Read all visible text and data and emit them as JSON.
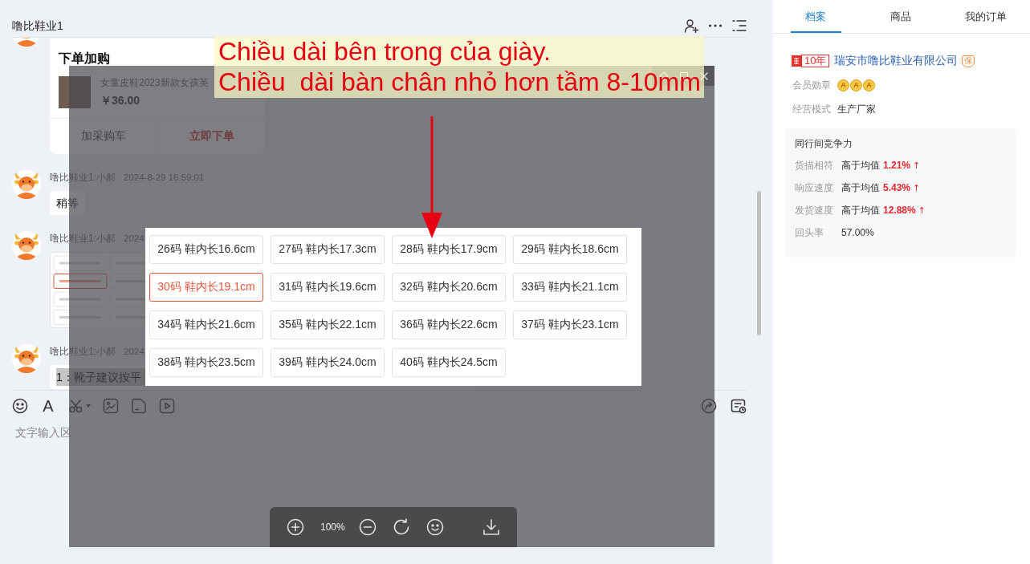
{
  "chat": {
    "title": "噜比鞋业1",
    "messages": [
      {
        "kind": "order_card",
        "card_title": "下单加购",
        "product_title": "女童皮鞋2023新款女孩英",
        "price": "￥36.00",
        "actions": [
          {
            "label": "加采购车",
            "primary": false
          },
          {
            "label": "立即下单",
            "primary": true
          }
        ]
      },
      {
        "kind": "text",
        "sender": "噜比鞋业1:小郝",
        "time": "2024-8-29 16:59:01",
        "text": "稍等",
        "highlighted": false
      },
      {
        "kind": "image",
        "sender": "噜比鞋业1:小郝",
        "time": "2024"
      },
      {
        "kind": "text",
        "sender": "噜比鞋业1:小郝",
        "time": "2024",
        "text": "1：靴子建议按平",
        "highlighted": true
      }
    ],
    "composer": {
      "format_label": "A",
      "placeholder": "文字输入区"
    }
  },
  "viewer": {
    "zoom": "100%",
    "sizes": [
      {
        "label": "26码 鞋内长16.6cm",
        "selected": false
      },
      {
        "label": "27码 鞋内长17.3cm",
        "selected": false
      },
      {
        "label": "28码 鞋内长17.9cm",
        "selected": false
      },
      {
        "label": "29码 鞋内长18.6cm",
        "selected": false
      },
      {
        "label": "30码 鞋内长19.1cm",
        "selected": true
      },
      {
        "label": "31码 鞋内长19.6cm",
        "selected": false
      },
      {
        "label": "32码 鞋内长20.6cm",
        "selected": false
      },
      {
        "label": "33码 鞋内长21.1cm",
        "selected": false
      },
      {
        "label": "34码 鞋内长21.6cm",
        "selected": false
      },
      {
        "label": "35码 鞋内长22.1cm",
        "selected": false
      },
      {
        "label": "36码 鞋内长22.6cm",
        "selected": false
      },
      {
        "label": "37码 鞋内长23.1cm",
        "selected": false
      },
      {
        "label": "38码 鞋内长23.5cm",
        "selected": false
      },
      {
        "label": "39码 鞋内长24.0cm",
        "selected": false
      },
      {
        "label": "40码 鞋内长24.5cm",
        "selected": false
      }
    ]
  },
  "annotation": {
    "lines": [
      "Chiều dài bên trong của giày.",
      "Chiều  dài bàn chân nhỏ hơn tầm 8-10mm"
    ]
  },
  "profile": {
    "tabs": [
      {
        "label": "档案",
        "selected": true
      },
      {
        "label": "商品",
        "selected": false
      },
      {
        "label": "我的订单",
        "selected": false
      }
    ],
    "years": "10年",
    "company": "瑞安市噜比鞋业有限公司",
    "guarantee": "保",
    "fields": [
      {
        "kind": "medals",
        "label": "会员勋章",
        "medals": [
          "A",
          "A",
          "A"
        ]
      },
      {
        "kind": "text",
        "label": "经营模式",
        "value": "生产厂家"
      }
    ],
    "competitiveness": {
      "title": "同行间竞争力",
      "rows": [
        {
          "label": "货描相符",
          "value": "高于均值",
          "delta": "1.21%",
          "trend": "↑"
        },
        {
          "label": "响应速度",
          "value": "高于均值",
          "delta": "5.43%",
          "trend": "↑"
        },
        {
          "label": "发货速度",
          "value": "高于均值",
          "delta": "12.88%",
          "trend": "↑"
        },
        {
          "label": "回头率",
          "value": "57.00%"
        }
      ]
    }
  }
}
